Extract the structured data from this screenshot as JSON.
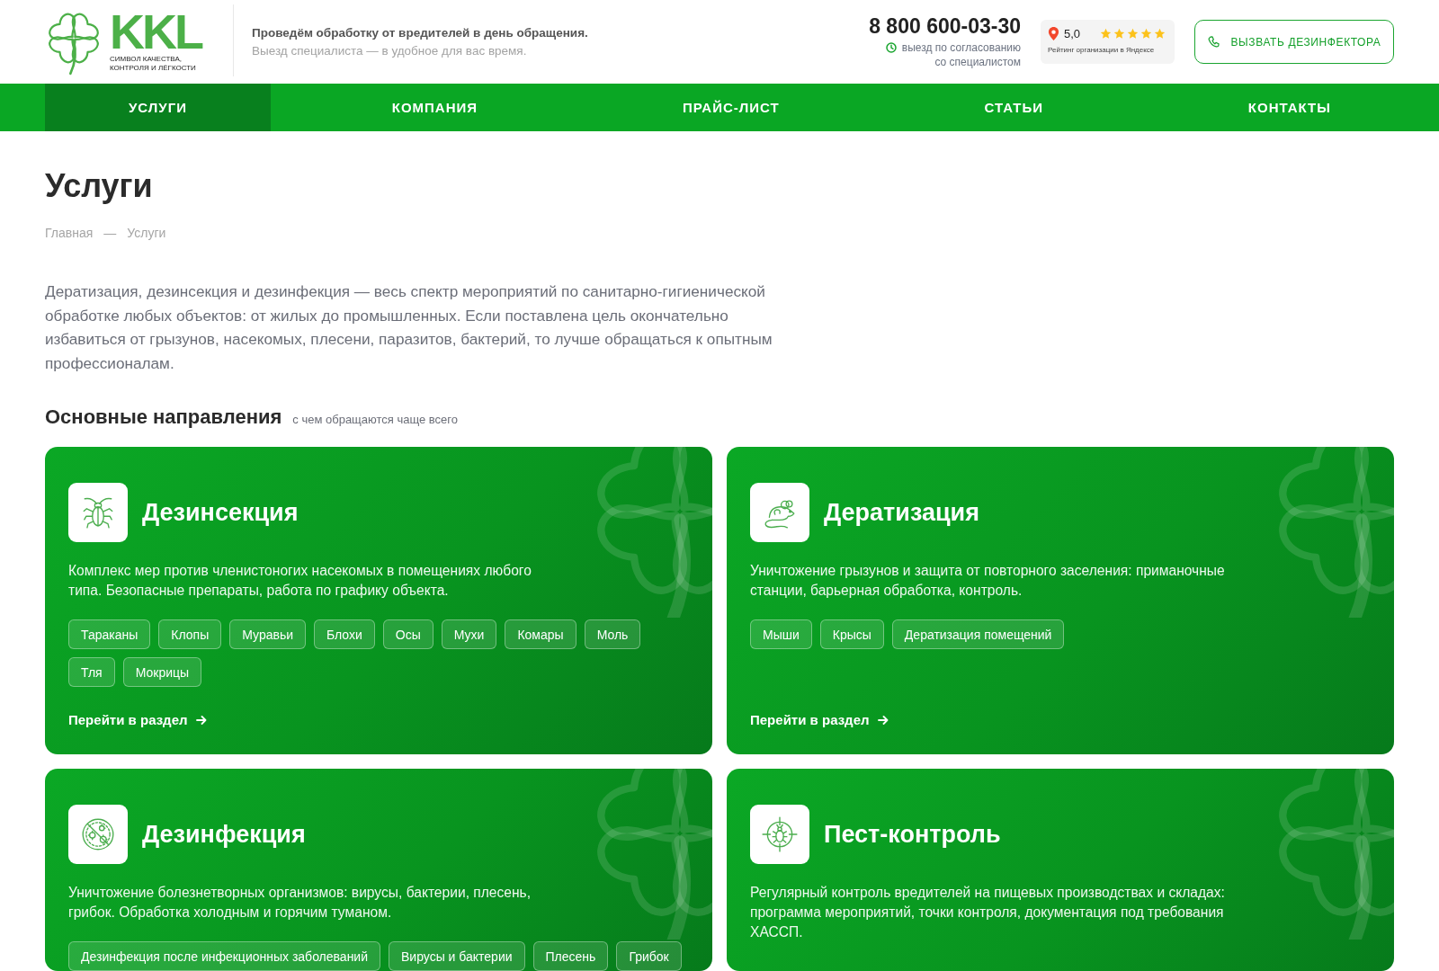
{
  "header": {
    "logo": {
      "name": "KKL",
      "slogan_lines": [
        "СИМВОЛ КАЧЕСТВА,",
        "КОНТРОЛЯ И ЛЁГКОСТИ"
      ]
    },
    "tagline": {
      "title": "Проведём обработку от вредителей в день обращения.",
      "subtitle": "Выезд специалиста — в удобное для вас время."
    },
    "phone": {
      "number": "8 800 600-03-30",
      "note_lines": [
        "выезд по согласованию",
        "со специалистом"
      ]
    },
    "rating": {
      "value": "5,0",
      "stars": 5,
      "caption": "Рейтинг организации в Яндексе"
    },
    "call_button": "ВЫЗВАТЬ ДЕЗИНФЕКТОРА"
  },
  "nav": [
    {
      "label": "УСЛУГИ",
      "selected": true
    },
    {
      "label": "КОМПАНИЯ",
      "selected": false
    },
    {
      "label": "ПРАЙС-ЛИСТ",
      "selected": false
    },
    {
      "label": "СТАТЬИ",
      "selected": false
    },
    {
      "label": "КОНТАКТЫ",
      "selected": false
    }
  ],
  "page": {
    "title": "Услуги",
    "breadcrumbs": [
      "Главная",
      "Услуги"
    ],
    "breadcrumb_separator": "—",
    "intro": "Дератизация, дезинсекция и дезинфекция — весь спектр мероприятий по санитарно-гигиенической обработке любых объектов: от жилых до промышленных. Если поставлена цель окончательно избавиться от грызунов, насекомых, плесени, паразитов, бактерий, то лучше обращаться к опытным профессионалам.",
    "section": {
      "title": "Основные направления",
      "subtitle": "с чем обращаются чаще всего"
    }
  },
  "cards": [
    {
      "title": "Дезинсекция",
      "description": "Комплекс мер против членистоногих насекомых в помещениях любого типа. Безопасные препараты, работа по графику объекта.",
      "tags": [
        "Тараканы",
        "Клопы",
        "Муравьи",
        "Блохи",
        "Осы",
        "Мухи",
        "Комары",
        "Моль",
        "Тля",
        "Мокрицы"
      ],
      "link": "Перейти в раздел"
    },
    {
      "title": "Дератизация",
      "description": "Уничтожение грызунов и защита от повторного заселения: приманочные станции, барьерная обработка, контроль.",
      "tags": [
        "Мыши",
        "Крысы",
        "Дератизация помещений"
      ],
      "link": "Перейти в раздел"
    },
    {
      "title": "Дезинфекция",
      "description": "Уничтожение болезнетворных организмов: вирусы, бактерии, плесень, грибок. Обработка холодным и горячим туманом.",
      "tags": [
        "Дезинфекция после инфекционных заболеваний",
        "Вирусы и бактерии",
        "Плесень",
        "Грибок"
      ]
    },
    {
      "title": "Пест-контроль",
      "description": "Регулярный контроль вредителей на пищевых производствах и складах: программа мероприятий, точки контроля, документация под требования ХАССП."
    }
  ]
}
